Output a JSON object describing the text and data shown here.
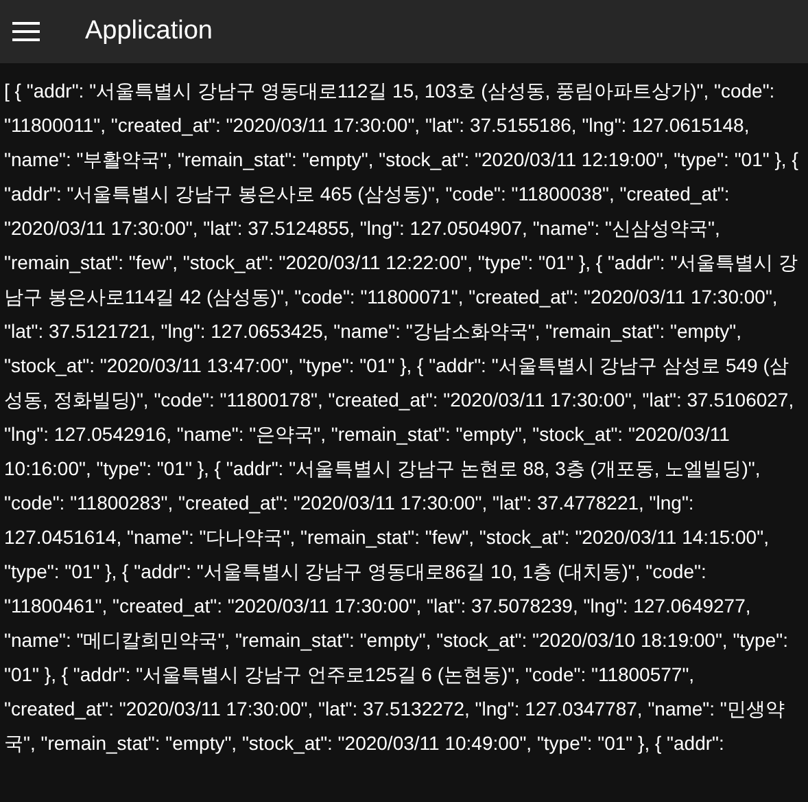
{
  "app_bar": {
    "title": "Application"
  },
  "content": {
    "text": "[ { \"addr\": \"서울특별시 강남구 영동대로112길 15, 103호 (삼성동, 풍림아파트상가)\", \"code\": \"11800011\", \"created_at\": \"2020/03/11 17:30:00\", \"lat\": 37.5155186, \"lng\": 127.0615148, \"name\": \"부활약국\", \"remain_stat\": \"empty\", \"stock_at\": \"2020/03/11 12:19:00\", \"type\": \"01\" }, { \"addr\": \"서울특별시 강남구 봉은사로 465 (삼성동)\", \"code\": \"11800038\", \"created_at\": \"2020/03/11 17:30:00\", \"lat\": 37.5124855, \"lng\": 127.0504907, \"name\": \"신삼성약국\", \"remain_stat\": \"few\", \"stock_at\": \"2020/03/11 12:22:00\", \"type\": \"01\" }, { \"addr\": \"서울특별시 강남구 봉은사로114길 42 (삼성동)\", \"code\": \"11800071\", \"created_at\": \"2020/03/11 17:30:00\", \"lat\": 37.5121721, \"lng\": 127.0653425, \"name\": \"강남소화약국\", \"remain_stat\": \"empty\", \"stock_at\": \"2020/03/11 13:47:00\", \"type\": \"01\" }, { \"addr\": \"서울특별시 강남구 삼성로 549 (삼성동, 정화빌딩)\", \"code\": \"11800178\", \"created_at\": \"2020/03/11 17:30:00\", \"lat\": 37.5106027, \"lng\": 127.0542916, \"name\": \"은약국\", \"remain_stat\": \"empty\", \"stock_at\": \"2020/03/11 10:16:00\", \"type\": \"01\" }, { \"addr\": \"서울특별시 강남구 논현로 88, 3층 (개포동, 노엘빌딩)\", \"code\": \"11800283\", \"created_at\": \"2020/03/11 17:30:00\", \"lat\": 37.4778221, \"lng\": 127.0451614, \"name\": \"다나약국\", \"remain_stat\": \"few\", \"stock_at\": \"2020/03/11 14:15:00\", \"type\": \"01\" }, { \"addr\": \"서울특별시 강남구 영동대로86길 10, 1층 (대치동)\", \"code\": \"11800461\", \"created_at\": \"2020/03/11 17:30:00\", \"lat\": 37.5078239, \"lng\": 127.0649277, \"name\": \"메디칼희민약국\", \"remain_stat\": \"empty\", \"stock_at\": \"2020/03/10 18:19:00\", \"type\": \"01\" }, { \"addr\": \"서울특별시 강남구 언주로125길 6 (논현동)\", \"code\": \"11800577\", \"created_at\": \"2020/03/11 17:30:00\", \"lat\": 37.5132272, \"lng\": 127.0347787, \"name\": \"민생약국\", \"remain_stat\": \"empty\", \"stock_at\": \"2020/03/11 10:49:00\", \"type\": \"01\" }, { \"addr\":"
  }
}
